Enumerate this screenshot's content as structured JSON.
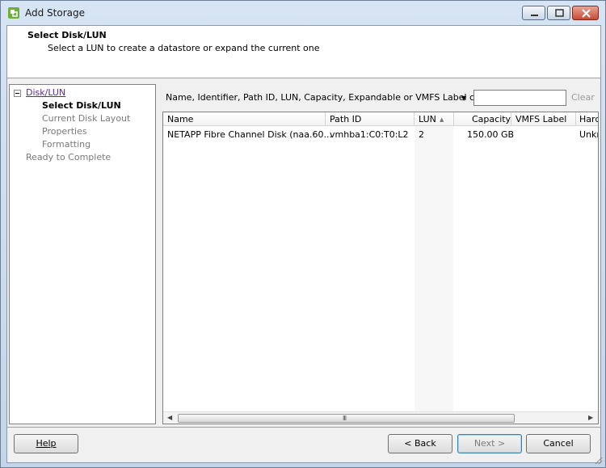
{
  "window": {
    "title": "Add Storage"
  },
  "header": {
    "title": "Select Disk/LUN",
    "subtitle": "Select a LUN to create a datastore or expand the current one"
  },
  "steps": {
    "group": "Disk/LUN",
    "items": [
      {
        "label": "Select Disk/LUN",
        "state": "current"
      },
      {
        "label": "Current Disk Layout",
        "state": "todo"
      },
      {
        "label": "Properties",
        "state": "todo"
      },
      {
        "label": "Formatting",
        "state": "todo"
      }
    ],
    "final": "Ready to Complete"
  },
  "filter": {
    "label": "Name, Identifier, Path ID, LUN, Capacity, Expandable or VMFS Label c...",
    "search_value": "",
    "clear_label": "Clear"
  },
  "table": {
    "columns": [
      "Name",
      "Path ID",
      "LUN",
      "Capacity",
      "VMFS Label",
      "Hard"
    ],
    "rows": [
      {
        "name": "NETAPP Fibre Channel Disk (naa.60...",
        "path_id": "vmhba1:C0:T0:L2",
        "lun": "2",
        "capacity": "150.00 GB",
        "vmfs_label": "",
        "hardware": "Unkn"
      }
    ],
    "sorted_by": "LUN"
  },
  "scrollbar": {
    "grip": "III"
  },
  "buttons": {
    "help": "Help",
    "back": "< Back",
    "next": "Next >",
    "cancel": "Cancel"
  },
  "colors": {
    "accent": "#3c7fb1",
    "link": "#5a2b8d",
    "disabled_text": "#7a7a7a"
  }
}
